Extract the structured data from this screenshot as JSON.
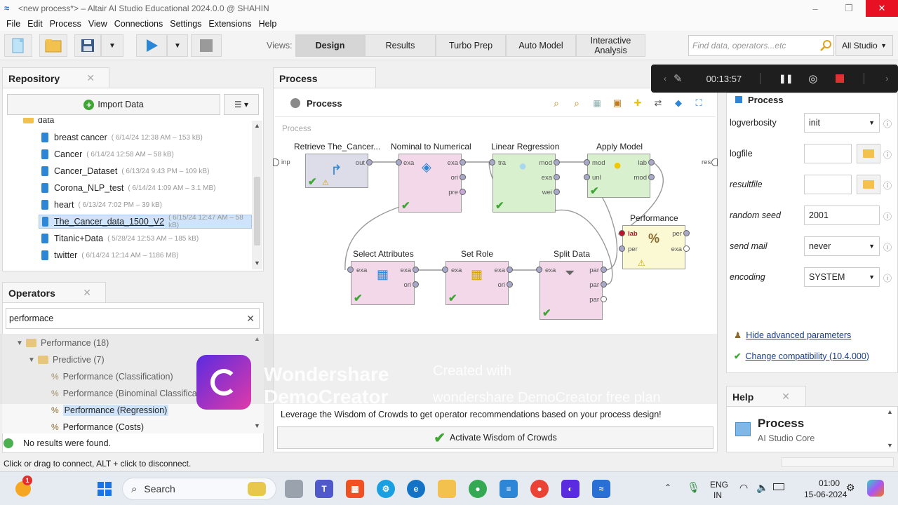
{
  "window": {
    "title": "<new process*> – Altair AI Studio Educational 2024.0.0 @ SHAHIN",
    "minimize": "–",
    "maximize": "❐",
    "close": "✕"
  },
  "menu": [
    "File",
    "Edit",
    "Process",
    "View",
    "Connections",
    "Settings",
    "Extensions",
    "Help"
  ],
  "toolbar": {
    "views_label": "Views:",
    "views": [
      "Design",
      "Results",
      "Turbo Prep",
      "Auto Model",
      "Interactive Analysis"
    ],
    "active_view": "Design",
    "search_placeholder": "Find data, operators...etc",
    "scope": "All Studio"
  },
  "repository": {
    "title": "Repository",
    "import_label": "Import Data",
    "folder_label": "data",
    "items": [
      {
        "name": "breast cancer",
        "meta": "( 6/14/24 12:38 AM – 153 kB)"
      },
      {
        "name": "Cancer",
        "meta": "( 6/14/24 12:58 AM – 58 kB)"
      },
      {
        "name": "Cancer_Dataset",
        "meta": "( 6/13/24 9:43 PM – 109 kB)"
      },
      {
        "name": "Corona_NLP_test",
        "meta": "( 6/14/24 1:09 AM – 3.1 MB)"
      },
      {
        "name": "heart",
        "meta": "( 6/13/24 7:02 PM – 39 kB)"
      },
      {
        "name": "The_Cancer_data_1500_V2",
        "meta": "( 6/15/24 12:47 AM – 58 kB)"
      },
      {
        "name": "Titanic+Data",
        "meta": "( 5/28/24 12:53 AM – 185 kB)"
      },
      {
        "name": "twitter",
        "meta": "( 6/14/24 12:14 AM – 1186 MB)"
      }
    ],
    "selected": "The_Cancer_data_1500_V2"
  },
  "operators": {
    "title": "Operators",
    "search_value": "performace",
    "tree": [
      {
        "label": "Performance (18)",
        "type": "folder",
        "level": 0
      },
      {
        "label": "Predictive (7)",
        "type": "folder",
        "level": 1
      },
      {
        "label": "Performance (Classification)",
        "type": "op",
        "level": 2
      },
      {
        "label": "Performance (Binominal Classification)",
        "type": "op",
        "level": 2
      },
      {
        "label": "Performance (Regression)",
        "type": "op",
        "level": 2
      },
      {
        "label": "Performance (Costs)",
        "type": "op",
        "level": 2
      }
    ],
    "selected": "Performance (Regression)",
    "status": "No results were found."
  },
  "process": {
    "tab_title": "Process",
    "header_title": "Process",
    "canvas_label": "Process",
    "left_port": "inp",
    "right_port": "res",
    "operators": {
      "retrieve": {
        "title": "Retrieve The_Cancer...",
        "ports": [
          "out"
        ]
      },
      "nominal": {
        "title": "Nominal to Numerical",
        "ports": [
          "exa",
          "exa",
          "ori",
          "pre"
        ]
      },
      "linreg": {
        "title": "Linear Regression",
        "ports": [
          "tra",
          "mod",
          "exa",
          "wei"
        ]
      },
      "apply": {
        "title": "Apply Model",
        "ports": [
          "mod",
          "lab",
          "unl",
          "mod"
        ]
      },
      "performance": {
        "title": "Performance",
        "ports": [
          "lab",
          "per",
          "per",
          "exa"
        ]
      },
      "select": {
        "title": "Select Attributes",
        "ports": [
          "exa",
          "exa",
          "ori"
        ]
      },
      "setrole": {
        "title": "Set Role",
        "ports": [
          "exa",
          "exa",
          "ori"
        ]
      },
      "split": {
        "title": "Split Data",
        "ports": [
          "exa",
          "par",
          "par",
          "par"
        ]
      }
    },
    "wisdom_text": "Leverage the Wisdom of Crowds to get operator recommendations based on your process design!",
    "wisdom_button": "Activate Wisdom of Crowds"
  },
  "parameters": {
    "title": "Process",
    "rows": [
      {
        "label": "logverbosity",
        "value": "init",
        "kind": "select"
      },
      {
        "label": "logfile",
        "value": "",
        "kind": "file"
      },
      {
        "label": "resultfile",
        "value": "",
        "kind": "file"
      },
      {
        "label": "random seed",
        "value": "2001",
        "kind": "text"
      },
      {
        "label": "send mail",
        "value": "never",
        "kind": "select"
      },
      {
        "label": "encoding",
        "value": "SYSTEM",
        "kind": "select"
      }
    ],
    "hide_advanced": "Hide advanced parameters",
    "compat": "Change compatibility (10.4.000)"
  },
  "help": {
    "title": "Help",
    "heading": "Process",
    "sub": "AI Studio Core"
  },
  "recorder": {
    "time": "00:13:57"
  },
  "watermark": {
    "brand1": "Wondershare",
    "brand2": "DemoCreator",
    "line1": "Created with",
    "line2": "wondershare DemoCreator free plan"
  },
  "statusbar": "Click or drag to connect, ALT + click to disconnect.",
  "taskbar": {
    "search": "Search",
    "lang1": "ENG",
    "lang2": "IN",
    "time": "01:00",
    "date": "15-06-2024",
    "badge": "1"
  },
  "colors": {
    "accent": "#2d86d6",
    "selected_bg": "#cfe3fb",
    "op_pink": "#f3d8e9",
    "op_green": "#d9f0cf",
    "op_yellow": "#fbf9d4",
    "check": "#3fa535"
  }
}
